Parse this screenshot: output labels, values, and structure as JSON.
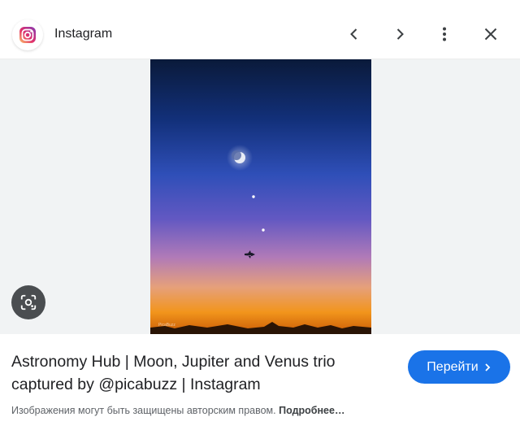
{
  "header": {
    "site_name": "Instagram",
    "site_icon": "instagram-logo",
    "buttons": [
      "chevron-left-icon",
      "chevron-right-icon",
      "more-vert-icon",
      "close-icon"
    ]
  },
  "preview": {
    "lens_icon": "google-lens-icon",
    "photo_watermark": "PicaBuzz"
  },
  "info": {
    "title": "Astronomy Hub | Moon, Jupiter and Venus trio captured by @picabuzz | Instagram",
    "goto_label": "Перейти",
    "copyright_text": "Изображения могут быть защищены авторским правом.",
    "more_label": "Подробнее…"
  },
  "colors": {
    "accent": "#1a73e8",
    "sky_top": "#0a1a3a",
    "sky_horizon": "#f08c1e"
  }
}
